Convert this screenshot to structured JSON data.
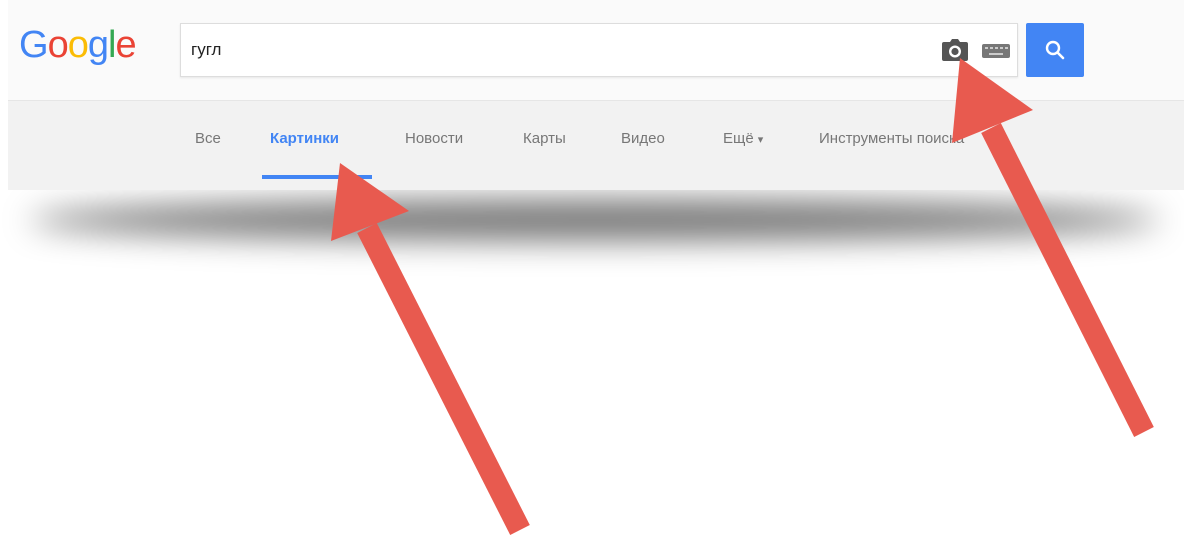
{
  "logo": {
    "letters": [
      "G",
      "o",
      "o",
      "g",
      "l",
      "e"
    ]
  },
  "search": {
    "value": "гугл"
  },
  "nav": {
    "tabs": [
      {
        "label": "Все"
      },
      {
        "label": "Картинки"
      },
      {
        "label": "Новости"
      },
      {
        "label": "Карты"
      },
      {
        "label": "Видео"
      },
      {
        "label": "Ещё"
      },
      {
        "label": "Инструменты поиска"
      }
    ],
    "active_tab": "Картинки"
  },
  "icons": {
    "camera": "camera-icon",
    "keyboard": "keyboard-icon",
    "search": "search-icon",
    "more_caret": "▾"
  },
  "colors": {
    "google_blue": "#4285f4",
    "google_red": "#ea4335",
    "google_yellow": "#fbbc05",
    "google_green": "#34a853",
    "arrow_red": "#e85a4f"
  }
}
